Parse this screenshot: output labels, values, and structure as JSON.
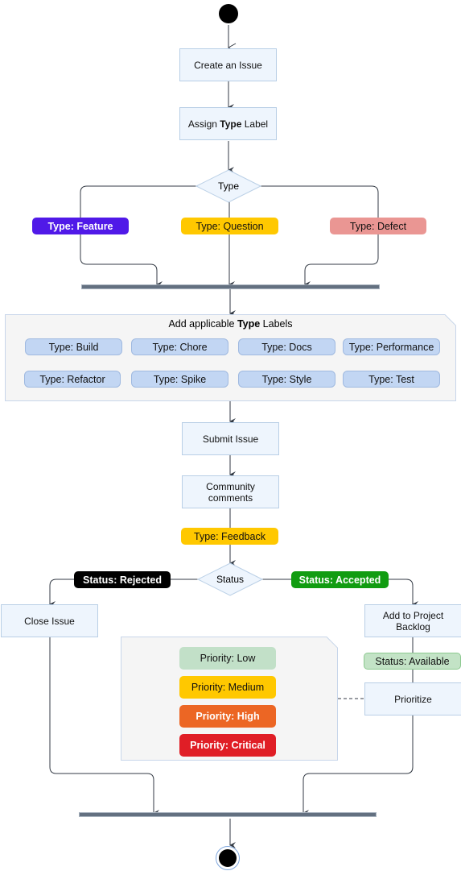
{
  "diagram": {
    "start_node": "initial-node",
    "end_node": "final-node",
    "actions": {
      "create_issue": "Create an Issue",
      "assign_type_prefix": "Assign ",
      "assign_type_bold": "Type",
      "assign_type_suffix": " Label",
      "submit_issue": "Submit Issue",
      "community_comments": "Community comments",
      "close_issue": "Close Issue",
      "add_to_backlog": "Add to Project Backlog",
      "prioritize": "Prioritize"
    },
    "decisions": {
      "type": "Type",
      "status": "Status"
    },
    "type_branches": [
      {
        "label": "Type: Feature",
        "bg": "#5019e8",
        "fg": "#ffffff",
        "bold": true
      },
      {
        "label": "Type: Question",
        "bg": "#ffc800",
        "fg": "#111111",
        "bold": false
      },
      {
        "label": "Type: Defect",
        "bg": "#ea9693",
        "fg": "#111111",
        "bold": false
      }
    ],
    "applicable_types": {
      "title_prefix": "Add applicable ",
      "title_bold": "Type",
      "title_suffix": " Labels",
      "labels": [
        "Type: Build",
        "Type: Chore",
        "Type: Docs",
        "Type: Performance",
        "Type: Refactor",
        "Type: Spike",
        "Type: Style",
        "Type: Test"
      ],
      "color": "#c2d6f3"
    },
    "feedback_label": {
      "label": "Type: Feedback",
      "bg": "#ffc800",
      "fg": "#111111"
    },
    "status_branches": {
      "rejected": {
        "label": "Status: Rejected",
        "bg": "#000000",
        "fg": "#ffffff"
      },
      "accepted": {
        "label": "Status: Accepted",
        "bg": "#119c11",
        "fg": "#ffffff"
      }
    },
    "available_label": {
      "label": "Status: Available",
      "bg": "#c3e3c6",
      "fg": "#111111"
    },
    "priorities": [
      {
        "label": "Priority: Low",
        "bg": "#c2e0c8",
        "fg": "#111111",
        "bold": false
      },
      {
        "label": "Priority: Medium",
        "bg": "#ffc800",
        "fg": "#111111",
        "bold": false
      },
      {
        "label": "Priority: High",
        "bg": "#ec6624",
        "fg": "#ffffff",
        "bold": true
      },
      {
        "label": "Priority: Critical",
        "bg": "#e01e26",
        "fg": "#ffffff",
        "bold": true
      }
    ]
  }
}
